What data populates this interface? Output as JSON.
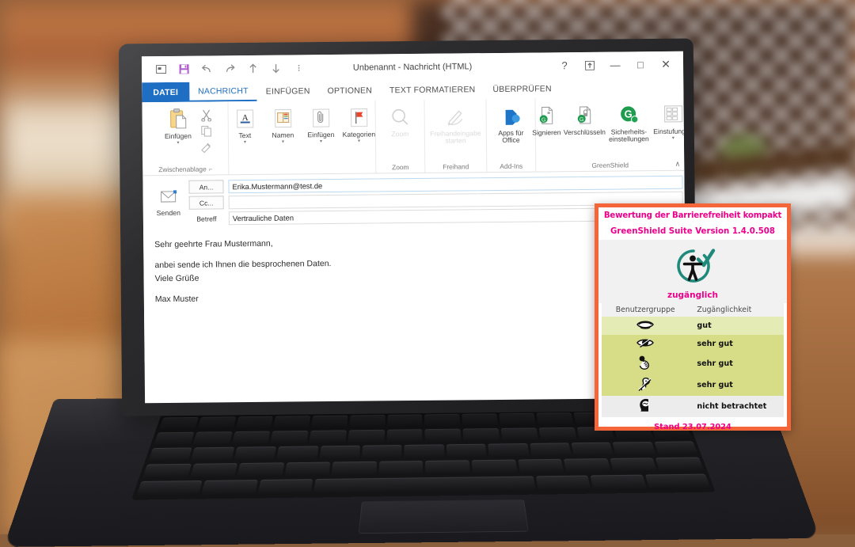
{
  "window": {
    "title": "Unbenannt - Nachricht (HTML)",
    "quick_access": [
      {
        "name": "restore-window-icon",
        "label": "Wiederherstellen"
      },
      {
        "name": "save-icon",
        "label": "Speichern"
      },
      {
        "name": "undo-icon",
        "label": "Rückgängig"
      },
      {
        "name": "redo-icon",
        "label": "Wiederholen"
      },
      {
        "name": "previous-item-icon",
        "label": "Vorheriges Element"
      },
      {
        "name": "next-item-icon",
        "label": "Nächstes Element"
      },
      {
        "name": "customize-qat-icon",
        "label": "Symbolleiste anpassen"
      }
    ],
    "controls": [
      {
        "name": "help-button",
        "glyph": "?"
      },
      {
        "name": "ribbon-display-options-button",
        "glyph": "⤒"
      },
      {
        "name": "minimize-button",
        "glyph": "—"
      },
      {
        "name": "maximize-button",
        "glyph": "□"
      },
      {
        "name": "close-button",
        "glyph": "✕"
      }
    ]
  },
  "tabs": [
    {
      "label": "DATEI",
      "state": "file"
    },
    {
      "label": "NACHRICHT",
      "state": "active"
    },
    {
      "label": "EINFÜGEN",
      "state": "normal"
    },
    {
      "label": "OPTIONEN",
      "state": "normal"
    },
    {
      "label": "TEXT FORMATIEREN",
      "state": "normal"
    },
    {
      "label": "ÜBERPRÜFEN",
      "state": "normal"
    }
  ],
  "ribbon": {
    "collapse_glyph": "∧",
    "groups": [
      {
        "name": "Zwischenablage",
        "items": [
          {
            "label": "Einfügen",
            "icon": "paste-icon",
            "caret": true,
            "dim": false,
            "big": true
          },
          {
            "label": "Ausschneiden",
            "icon": "cut-icon",
            "dim": false,
            "small": true
          },
          {
            "label": "Kopieren",
            "icon": "copy-icon",
            "dim": false,
            "small": true
          },
          {
            "label": "Format übertragen",
            "icon": "format-painter-icon",
            "dim": false,
            "small": true
          }
        ],
        "dialog_launcher": true
      },
      {
        "name": "",
        "items": [
          {
            "label": "Text",
            "icon": "text-icon",
            "caret": true,
            "dim": false
          },
          {
            "label": "Namen",
            "icon": "names-icon",
            "caret": true,
            "dim": false
          },
          {
            "label": "Einfügen",
            "icon": "attach-icon",
            "caret": true,
            "dim": false
          },
          {
            "label": "Kategorien",
            "icon": "flag-icon",
            "caret": true,
            "dim": false
          }
        ]
      },
      {
        "name": "Zoom",
        "items": [
          {
            "label": "Zoom",
            "icon": "magnifier-icon",
            "dim": true
          }
        ]
      },
      {
        "name": "Freihand",
        "items": [
          {
            "label": "Freihandeingabe starten",
            "icon": "ink-pen-icon",
            "dim": true
          }
        ]
      },
      {
        "name": "Add-Ins",
        "items": [
          {
            "label": "Apps für Office",
            "icon": "office-apps-icon",
            "dim": false
          }
        ]
      },
      {
        "name": "GreenShield",
        "items": [
          {
            "label": "Signieren",
            "icon": "sign-document-icon",
            "dim": false
          },
          {
            "label": "Verschlüsseln",
            "icon": "encrypt-document-icon",
            "dim": false
          },
          {
            "label": "Sicherheits- einstellungen",
            "icon": "greenshield-security-icon",
            "dim": false
          },
          {
            "label": "Einstufungen",
            "icon": "classification-grid-icon",
            "caret": true,
            "dim": false
          }
        ]
      }
    ]
  },
  "compose": {
    "send_label": "Senden",
    "send_icon": "send-envelope-icon",
    "to_button": "An...",
    "cc_button": "Cc...",
    "subject_label": "Betreff",
    "to_value": "Erika.Mustermann@test.de",
    "cc_value": "",
    "subject_value": "Vertrauliche Daten",
    "body": [
      "Sehr geehrte Frau Mustermann,",
      "anbei sende ich Ihnen die besprochenen Daten.",
      "Viele Grüße",
      "Max Muster"
    ]
  },
  "panel": {
    "title": "Bewertung der Barrierefreiheit kompakt",
    "version": "GreenShield Suite Version 1.4.0.508",
    "badge_icon": "accessibility-check-icon",
    "status": "zugänglich",
    "columns": [
      "Benutzergruppe",
      "Zugänglichkeit"
    ],
    "rows": [
      {
        "icon": "blind-eye-icon",
        "group": "Blind",
        "value": "gut",
        "row_color": "#e5ebb4"
      },
      {
        "icon": "low-vision-eye-icon",
        "group": "Sehbehindert",
        "value": "sehr gut",
        "row_color": "#d7dd87"
      },
      {
        "icon": "motor-hand-icon",
        "group": "Motorisch eingeschränkt",
        "value": "sehr gut",
        "row_color": "#d7dd87"
      },
      {
        "icon": "deaf-ear-icon",
        "group": "Gehörlos",
        "value": "sehr gut",
        "row_color": "#d7dd87"
      },
      {
        "icon": "cognitive-head-icon",
        "group": "Kognitiv eingeschränkt",
        "value": "nicht betrachtet",
        "row_color": "#ececec"
      }
    ],
    "date": "Stand 23.07.2024",
    "colors": {
      "border": "#f4663a",
      "accent": "#ec008c",
      "badge": "#1f8a7c"
    }
  }
}
